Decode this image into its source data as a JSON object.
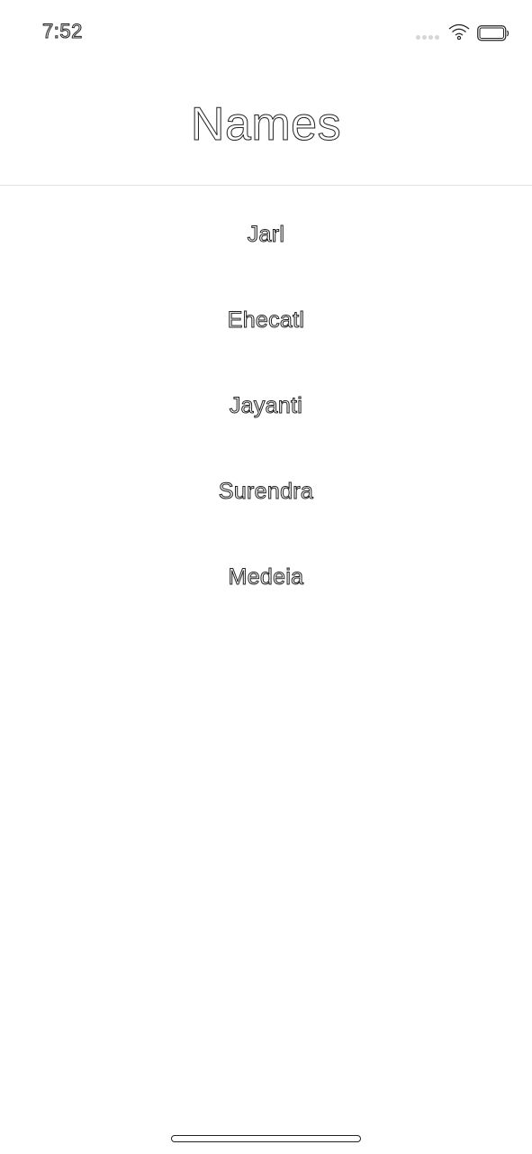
{
  "status_bar": {
    "time": "7:52",
    "icons": [
      "cellular-signal-icon",
      "wifi-icon",
      "battery-icon"
    ]
  },
  "nav": {
    "title": "Names"
  },
  "names": [
    {
      "label": "Jarl"
    },
    {
      "label": "Ehecatl"
    },
    {
      "label": "Jayanti"
    },
    {
      "label": "Surendra"
    },
    {
      "label": "Medeia"
    }
  ],
  "colors": {
    "background": "#ffffff",
    "text_outline": "#222222",
    "divider": "#e2e2e2",
    "signal_dots": "#d6d6d6"
  }
}
